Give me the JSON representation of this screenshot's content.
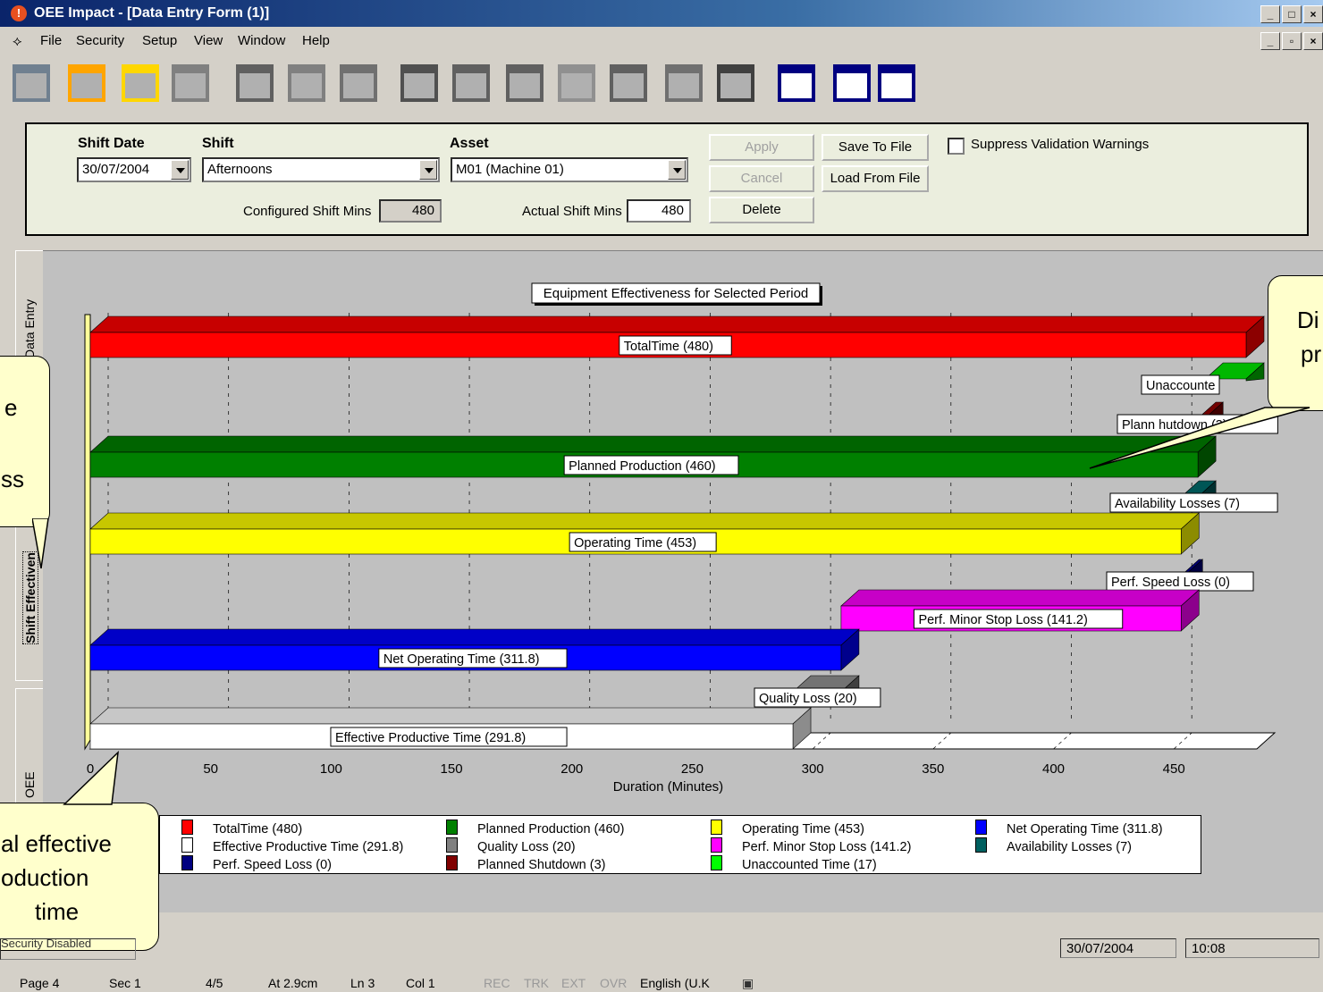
{
  "window": {
    "title": "OEE Impact - [Data Entry Form (1)]",
    "buttons": [
      "_",
      "□",
      "×"
    ]
  },
  "menu": [
    "File",
    "Security",
    "Setup",
    "View",
    "Window",
    "Help"
  ],
  "toolbar_icons": [
    "data-entry-icon",
    "add-chart-icon",
    "open-folder-icon",
    "save-icon",
    "report-icon",
    "layout-icon",
    "edit-icon",
    "select-arrow-icon",
    "refresh-icon",
    "resize-icon",
    "zoom-icon",
    "frame-icon",
    "print-icon",
    "copy-icon",
    "window-cascade-icon",
    "window-tile-horizontal-icon",
    "window-tile-vertical-icon"
  ],
  "form": {
    "shift_date_label": "Shift Date",
    "shift_date_value": "30/07/2004",
    "shift_label": "Shift",
    "shift_value": "Afternoons",
    "asset_label": "Asset",
    "asset_value": "M01 (Machine 01)",
    "configured_label": "Configured Shift Mins",
    "configured_value": "480",
    "actual_label": "Actual Shift Mins",
    "actual_value": "480",
    "apply": "Apply",
    "cancel": "Cancel",
    "delete": "Delete",
    "save_to_file": "Save To File",
    "load_from_file": "Load From File",
    "suppress": "Suppress Validation Warnings"
  },
  "tabs": {
    "data_entry": "Data Entry",
    "shift_effectiveness": "Shift Effectiven",
    "oee": "OEE"
  },
  "chart_data": {
    "type": "bar",
    "orientation": "horizontal",
    "title": "Equipment Effectiveness for Selected Period",
    "xlabel": "Duration (Minutes)",
    "xlim": [
      0,
      480
    ],
    "xticks": [
      0,
      50,
      100,
      150,
      200,
      250,
      300,
      350,
      400,
      450
    ],
    "grid": true,
    "bars": [
      {
        "name": "TotalTime (480)",
        "start": 0,
        "end": 480,
        "color": "#ff0000"
      },
      {
        "name": "Unaccounted Time (17)",
        "start": 463,
        "end": 480,
        "color": "#00cc00",
        "label": "Unaccounte"
      },
      {
        "name": "Planned Shutdown (3)",
        "start": 460,
        "end": 463,
        "color": "#800000",
        "label": "Plann      hutdown (3)"
      },
      {
        "name": "Planned Production (460)",
        "start": 0,
        "end": 460,
        "color": "#008000"
      },
      {
        "name": "Availability Losses (7)",
        "start": 453,
        "end": 460,
        "color": "#006060"
      },
      {
        "name": "Operating Time (453)",
        "start": 0,
        "end": 453,
        "color": "#ffff00"
      },
      {
        "name": "Perf. Speed Loss (0)",
        "start": 453,
        "end": 453,
        "color": "#000080"
      },
      {
        "name": "Perf. Minor Stop Loss (141.2)",
        "start": 311.8,
        "end": 453,
        "color": "#ff00ff"
      },
      {
        "name": "Net Operating Time (311.8)",
        "start": 0,
        "end": 311.8,
        "color": "#0000ff"
      },
      {
        "name": "Quality Loss (20)",
        "start": 291.8,
        "end": 311.8,
        "color": "#808080"
      },
      {
        "name": "Effective Productive Time (291.8)",
        "start": 0,
        "end": 291.8,
        "color": "#ffffff"
      }
    ],
    "legend": [
      {
        "name": "TotalTime (480)",
        "color": "#ff0000"
      },
      {
        "name": "Effective Productive Time (291.8)",
        "color": "#ffffff"
      },
      {
        "name": "Perf. Speed Loss (0)",
        "color": "#000080"
      },
      {
        "name": "Planned Production (460)",
        "color": "#008000"
      },
      {
        "name": "Quality Loss (20)",
        "color": "#808080"
      },
      {
        "name": "Planned Shutdown (3)",
        "color": "#800000"
      },
      {
        "name": "Operating Time (453)",
        "color": "#ffff00"
      },
      {
        "name": "Perf. Minor Stop Loss (141.2)",
        "color": "#ff00ff"
      },
      {
        "name": "Unaccounted Time (17)",
        "color": "#00ff00"
      },
      {
        "name": "Net Operating Time (311.8)",
        "color": "#0000ff"
      },
      {
        "name": "Availability Losses (7)",
        "color": "#006060"
      }
    ]
  },
  "callouts": {
    "left_top": [
      "e",
      "",
      "ss"
    ],
    "right_top": [
      "Di",
      "pr"
    ],
    "bottom_left": [
      "al effective",
      "oduction",
      "time"
    ]
  },
  "status": {
    "left": "Security Disabled",
    "date": "30/07/2004",
    "time": "10:08"
  },
  "word_status": {
    "page": "Page 4",
    "sec": "Sec 1",
    "pages": "4/5",
    "at": "At 2.9cm",
    "ln": "Ln 3",
    "col": "Col 1",
    "rec": "REC",
    "trk": "TRK",
    "ext": "EXT",
    "ovr": "OVR",
    "lang": "English (U.K"
  }
}
